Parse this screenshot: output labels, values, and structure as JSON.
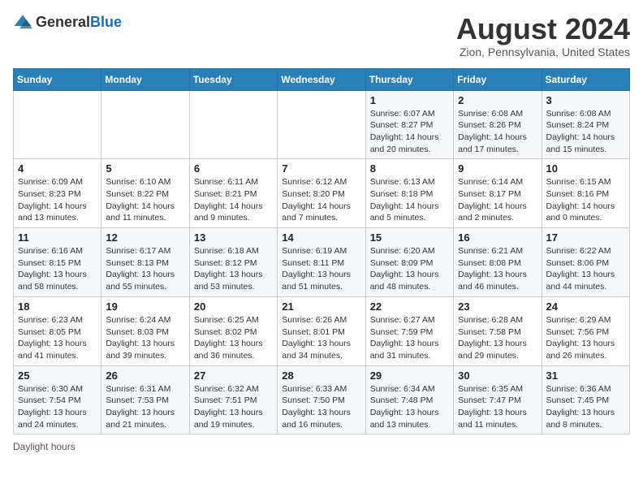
{
  "header": {
    "logo_general": "General",
    "logo_blue": "Blue",
    "title": "August 2024",
    "subtitle": "Zion, Pennsylvania, United States"
  },
  "weekdays": [
    "Sunday",
    "Monday",
    "Tuesday",
    "Wednesday",
    "Thursday",
    "Friday",
    "Saturday"
  ],
  "weeks": [
    [
      {
        "day": "",
        "info": ""
      },
      {
        "day": "",
        "info": ""
      },
      {
        "day": "",
        "info": ""
      },
      {
        "day": "",
        "info": ""
      },
      {
        "day": "1",
        "info": "Sunrise: 6:07 AM\nSunset: 8:27 PM\nDaylight: 14 hours and 20 minutes."
      },
      {
        "day": "2",
        "info": "Sunrise: 6:08 AM\nSunset: 8:26 PM\nDaylight: 14 hours and 17 minutes."
      },
      {
        "day": "3",
        "info": "Sunrise: 6:08 AM\nSunset: 8:24 PM\nDaylight: 14 hours and 15 minutes."
      }
    ],
    [
      {
        "day": "4",
        "info": "Sunrise: 6:09 AM\nSunset: 8:23 PM\nDaylight: 14 hours and 13 minutes."
      },
      {
        "day": "5",
        "info": "Sunrise: 6:10 AM\nSunset: 8:22 PM\nDaylight: 14 hours and 11 minutes."
      },
      {
        "day": "6",
        "info": "Sunrise: 6:11 AM\nSunset: 8:21 PM\nDaylight: 14 hours and 9 minutes."
      },
      {
        "day": "7",
        "info": "Sunrise: 6:12 AM\nSunset: 8:20 PM\nDaylight: 14 hours and 7 minutes."
      },
      {
        "day": "8",
        "info": "Sunrise: 6:13 AM\nSunset: 8:18 PM\nDaylight: 14 hours and 5 minutes."
      },
      {
        "day": "9",
        "info": "Sunrise: 6:14 AM\nSunset: 8:17 PM\nDaylight: 14 hours and 2 minutes."
      },
      {
        "day": "10",
        "info": "Sunrise: 6:15 AM\nSunset: 8:16 PM\nDaylight: 14 hours and 0 minutes."
      }
    ],
    [
      {
        "day": "11",
        "info": "Sunrise: 6:16 AM\nSunset: 8:15 PM\nDaylight: 13 hours and 58 minutes."
      },
      {
        "day": "12",
        "info": "Sunrise: 6:17 AM\nSunset: 8:13 PM\nDaylight: 13 hours and 55 minutes."
      },
      {
        "day": "13",
        "info": "Sunrise: 6:18 AM\nSunset: 8:12 PM\nDaylight: 13 hours and 53 minutes."
      },
      {
        "day": "14",
        "info": "Sunrise: 6:19 AM\nSunset: 8:11 PM\nDaylight: 13 hours and 51 minutes."
      },
      {
        "day": "15",
        "info": "Sunrise: 6:20 AM\nSunset: 8:09 PM\nDaylight: 13 hours and 48 minutes."
      },
      {
        "day": "16",
        "info": "Sunrise: 6:21 AM\nSunset: 8:08 PM\nDaylight: 13 hours and 46 minutes."
      },
      {
        "day": "17",
        "info": "Sunrise: 6:22 AM\nSunset: 8:06 PM\nDaylight: 13 hours and 44 minutes."
      }
    ],
    [
      {
        "day": "18",
        "info": "Sunrise: 6:23 AM\nSunset: 8:05 PM\nDaylight: 13 hours and 41 minutes."
      },
      {
        "day": "19",
        "info": "Sunrise: 6:24 AM\nSunset: 8:03 PM\nDaylight: 13 hours and 39 minutes."
      },
      {
        "day": "20",
        "info": "Sunrise: 6:25 AM\nSunset: 8:02 PM\nDaylight: 13 hours and 36 minutes."
      },
      {
        "day": "21",
        "info": "Sunrise: 6:26 AM\nSunset: 8:01 PM\nDaylight: 13 hours and 34 minutes."
      },
      {
        "day": "22",
        "info": "Sunrise: 6:27 AM\nSunset: 7:59 PM\nDaylight: 13 hours and 31 minutes."
      },
      {
        "day": "23",
        "info": "Sunrise: 6:28 AM\nSunset: 7:58 PM\nDaylight: 13 hours and 29 minutes."
      },
      {
        "day": "24",
        "info": "Sunrise: 6:29 AM\nSunset: 7:56 PM\nDaylight: 13 hours and 26 minutes."
      }
    ],
    [
      {
        "day": "25",
        "info": "Sunrise: 6:30 AM\nSunset: 7:54 PM\nDaylight: 13 hours and 24 minutes."
      },
      {
        "day": "26",
        "info": "Sunrise: 6:31 AM\nSunset: 7:53 PM\nDaylight: 13 hours and 21 minutes."
      },
      {
        "day": "27",
        "info": "Sunrise: 6:32 AM\nSunset: 7:51 PM\nDaylight: 13 hours and 19 minutes."
      },
      {
        "day": "28",
        "info": "Sunrise: 6:33 AM\nSunset: 7:50 PM\nDaylight: 13 hours and 16 minutes."
      },
      {
        "day": "29",
        "info": "Sunrise: 6:34 AM\nSunset: 7:48 PM\nDaylight: 13 hours and 13 minutes."
      },
      {
        "day": "30",
        "info": "Sunrise: 6:35 AM\nSunset: 7:47 PM\nDaylight: 13 hours and 11 minutes."
      },
      {
        "day": "31",
        "info": "Sunrise: 6:36 AM\nSunset: 7:45 PM\nDaylight: 13 hours and 8 minutes."
      }
    ]
  ],
  "footer": {
    "daylight_label": "Daylight hours"
  }
}
